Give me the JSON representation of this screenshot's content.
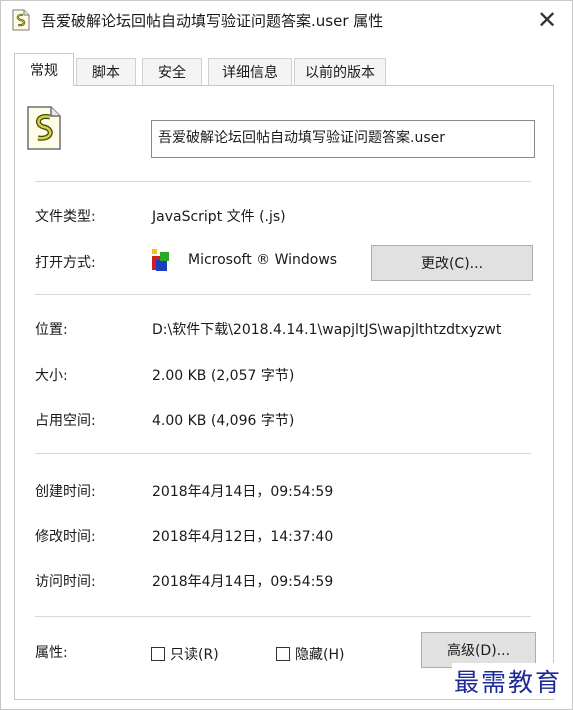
{
  "window": {
    "title": "吾爱破解论坛回帖自动填写验证问题答案.user 属性",
    "close_glyph": "✕"
  },
  "tabs": [
    {
      "label": "常规",
      "active": true
    },
    {
      "label": "脚本",
      "active": false
    },
    {
      "label": "安全",
      "active": false
    },
    {
      "label": "详细信息",
      "active": false
    },
    {
      "label": "以前的版本",
      "active": false
    }
  ],
  "general": {
    "filename": "吾爱破解论坛回帖自动填写验证问题答案.user",
    "file_type_label": "文件类型:",
    "file_type_value": "JavaScript 文件 (.js)",
    "opens_with_label": "打开方式:",
    "opens_with_value": "Microsoft ® Windows",
    "change_button": "更改(C)...",
    "location_label": "位置:",
    "location_value": "D:\\软件下载\\2018.4.14.1\\wapjltJS\\wapjlthtzdtxyzwt",
    "size_label": "大小:",
    "size_value": "2.00 KB (2,057 字节)",
    "disk_size_label": "占用空间:",
    "disk_size_value": "4.00 KB (4,096 字节)",
    "created_label": "创建时间:",
    "created_value": "2018年4月14日，09:54:59",
    "modified_label": "修改时间:",
    "modified_value": "2018年4月12日，14:37:40",
    "accessed_label": "访问时间:",
    "accessed_value": "2018年4月14日，09:54:59",
    "attributes_label": "属性:",
    "readonly_label": "只读(R)",
    "readonly_checked": false,
    "hidden_label": "隐藏(H)",
    "hidden_checked": false,
    "advanced_button": "高级(D)..."
  },
  "watermark": {
    "text": "最需教育",
    "color": "#1e2a9a"
  },
  "icons": {
    "title": "script-file-icon",
    "file": "script-file-icon",
    "app": "windows-script-host-icon"
  }
}
